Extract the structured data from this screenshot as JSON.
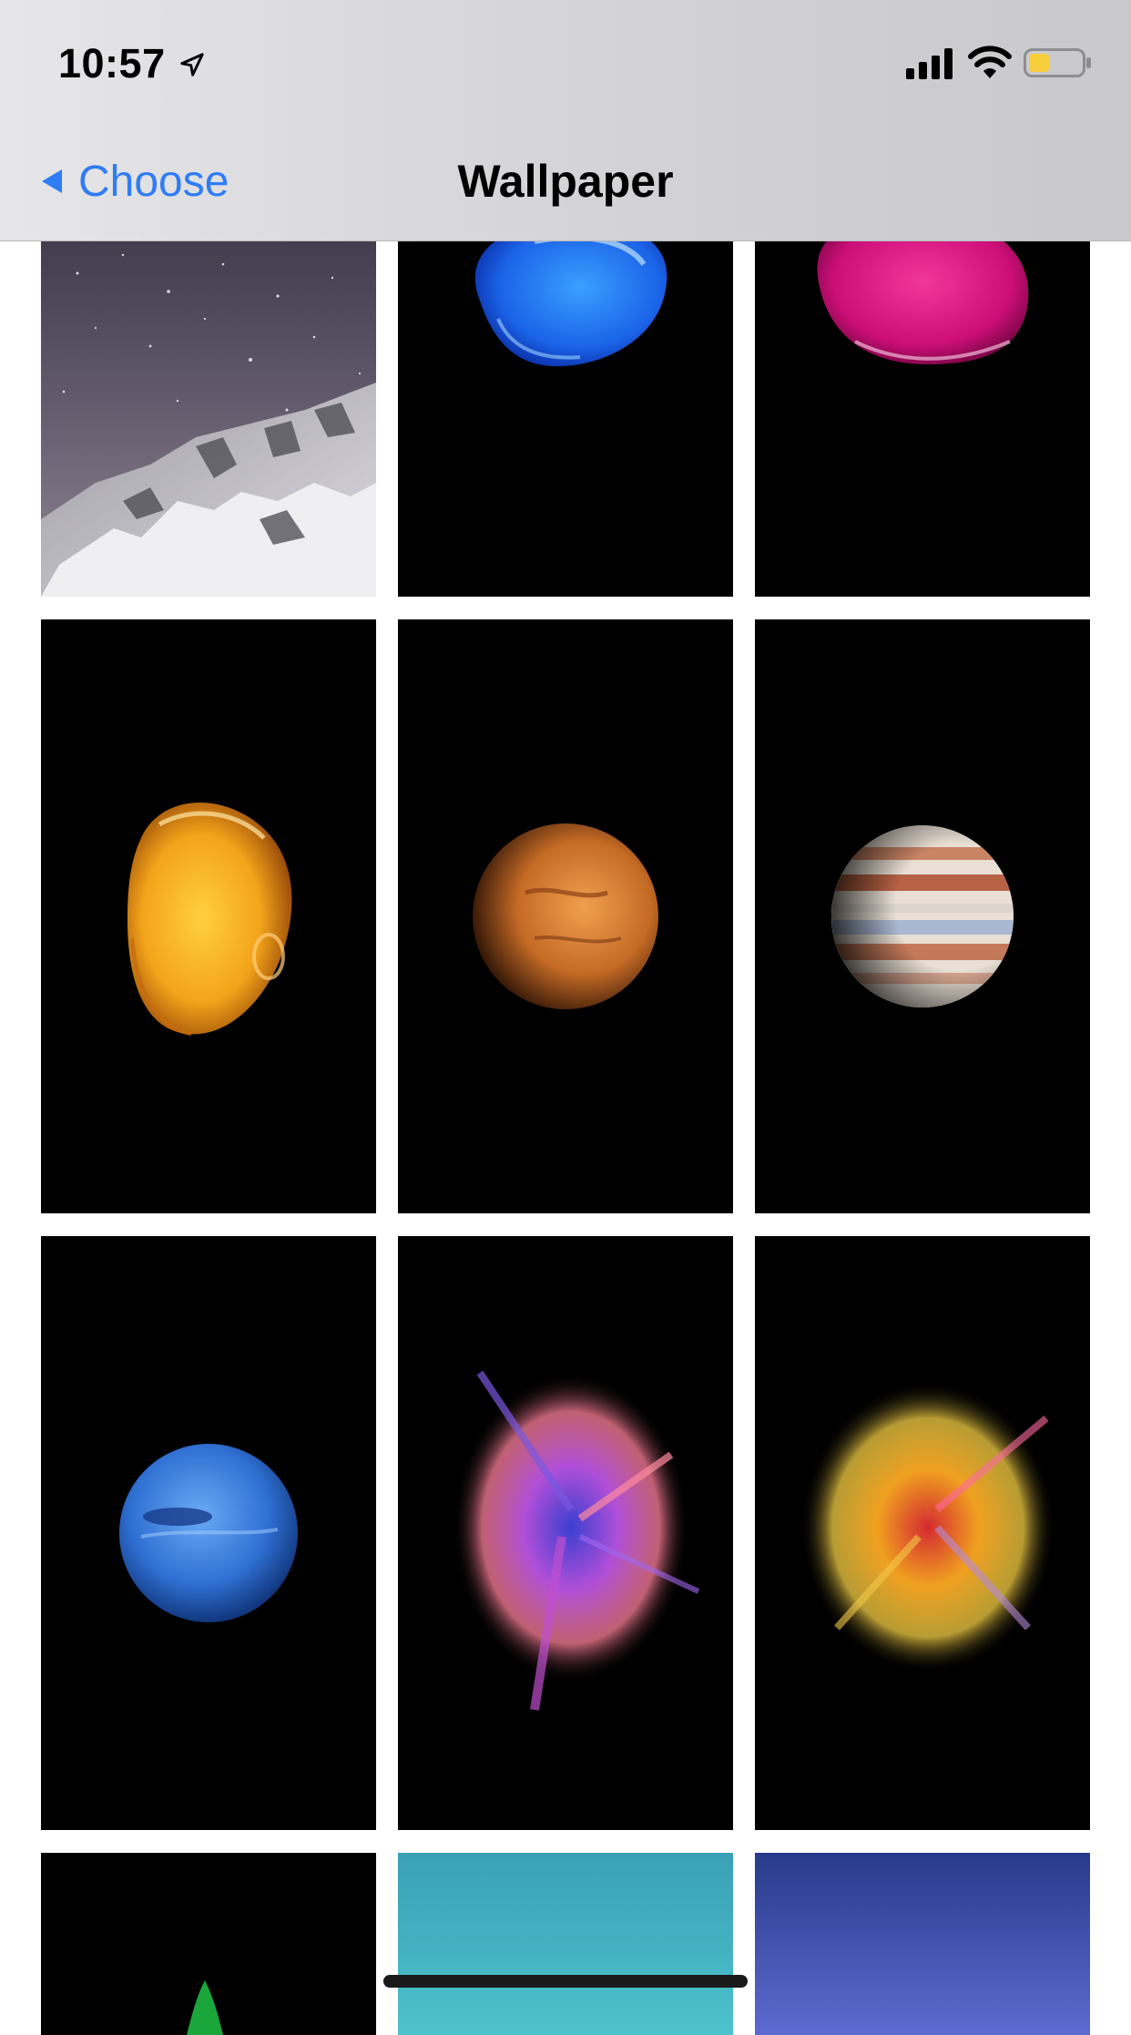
{
  "status_bar": {
    "time": "10:57",
    "icons": [
      "location-arrow-icon",
      "signal-icon",
      "wifi-icon",
      "battery-icon"
    ],
    "battery_color": "#f6cd3b"
  },
  "nav": {
    "back_label": "Choose",
    "title": "Wallpaper",
    "accent": "#2f7cf6"
  },
  "wallpapers": [
    {
      "subject": "starry-mountain"
    },
    {
      "subject": "blue-liquid-drop"
    },
    {
      "subject": "magenta-liquid-drop"
    },
    {
      "subject": "amber-liquid-drop"
    },
    {
      "subject": "mars"
    },
    {
      "subject": "jupiter"
    },
    {
      "subject": "neptune"
    },
    {
      "subject": "pink-purple-powder-burst"
    },
    {
      "subject": "yellow-red-powder-burst"
    },
    {
      "subject": "green-aurora"
    },
    {
      "subject": "teal-gradient"
    },
    {
      "subject": "indigo-gradient"
    }
  ]
}
